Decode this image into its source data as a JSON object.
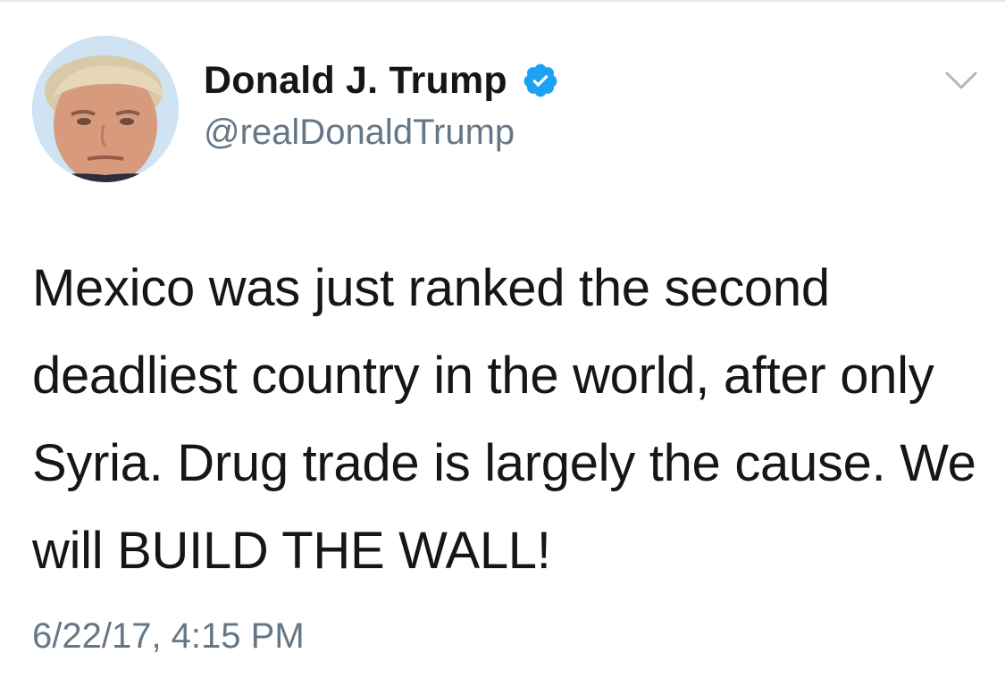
{
  "tweet": {
    "author": {
      "display_name": "Donald J. Trump",
      "handle": "@realDonaldTrump",
      "verified": true,
      "avatar_icon": "profile-photo",
      "verified_icon": "verified-badge-icon"
    },
    "menu_icon": "chevron-down-icon",
    "text": "Mexico was just ranked the second deadliest country in the world, after only Syria. Drug trade is largely the cause. We will BUILD THE WALL!",
    "timestamp": "6/22/17, 4:15 PM"
  },
  "colors": {
    "primary_text": "#14171a",
    "secondary_text": "#657786",
    "verified_blue": "#1da1f2",
    "border": "#e1e8ed"
  }
}
